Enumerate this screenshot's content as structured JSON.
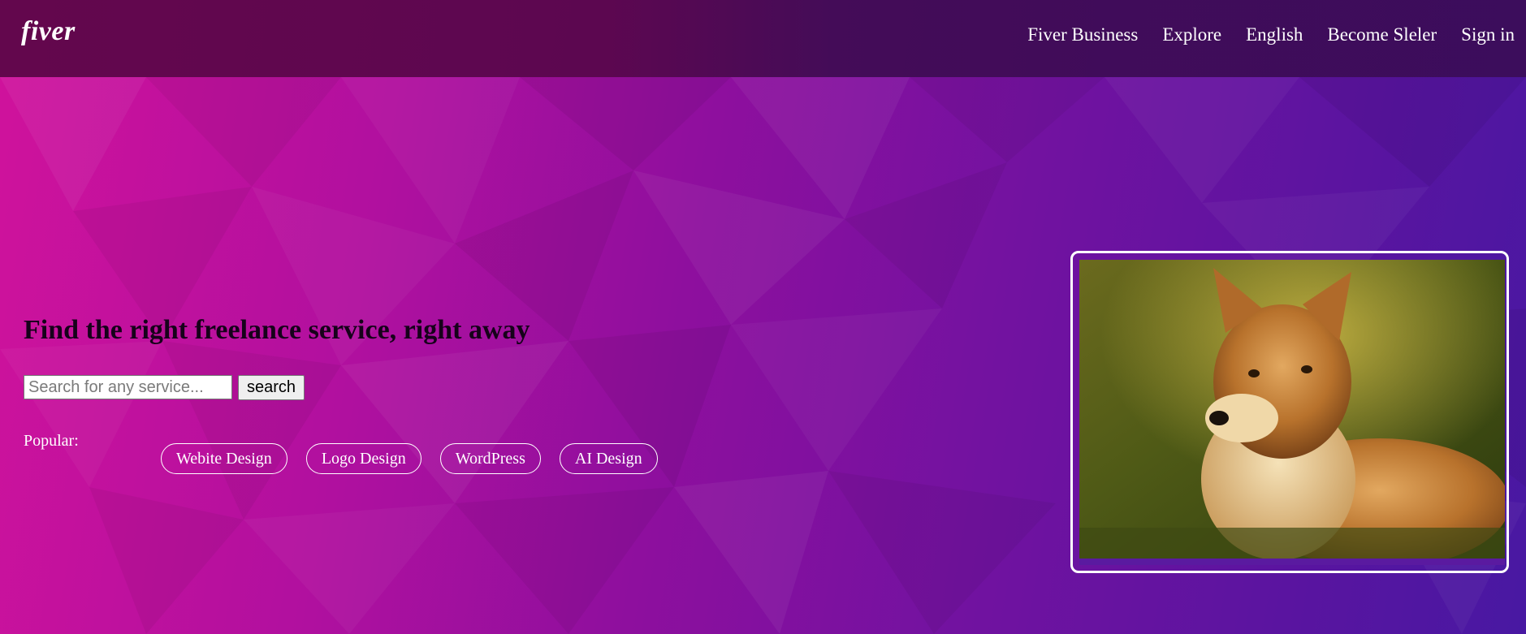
{
  "brand": {
    "logo": "fiver"
  },
  "nav": {
    "items": [
      {
        "label": "Fiver Business"
      },
      {
        "label": "Explore"
      },
      {
        "label": "English"
      },
      {
        "label": "Become Sleler"
      },
      {
        "label": "Sign in"
      }
    ]
  },
  "hero": {
    "heading": "Find the right freelance service, right away",
    "search": {
      "placeholder": "Search for any service...",
      "value": "",
      "button_label": "search"
    },
    "popular": {
      "label": "Popular:",
      "tags": [
        {
          "label": "Webite Design"
        },
        {
          "label": "Logo Design"
        },
        {
          "label": "WordPress"
        },
        {
          "label": "AI Design"
        }
      ]
    }
  },
  "image": {
    "subject": "dog-photo"
  },
  "colors": {
    "gradient_start": "#d0129c",
    "gradient_end": "#4818a2",
    "navbar": "#55064a",
    "text_light": "#ffffff",
    "heading": "#16021a"
  }
}
